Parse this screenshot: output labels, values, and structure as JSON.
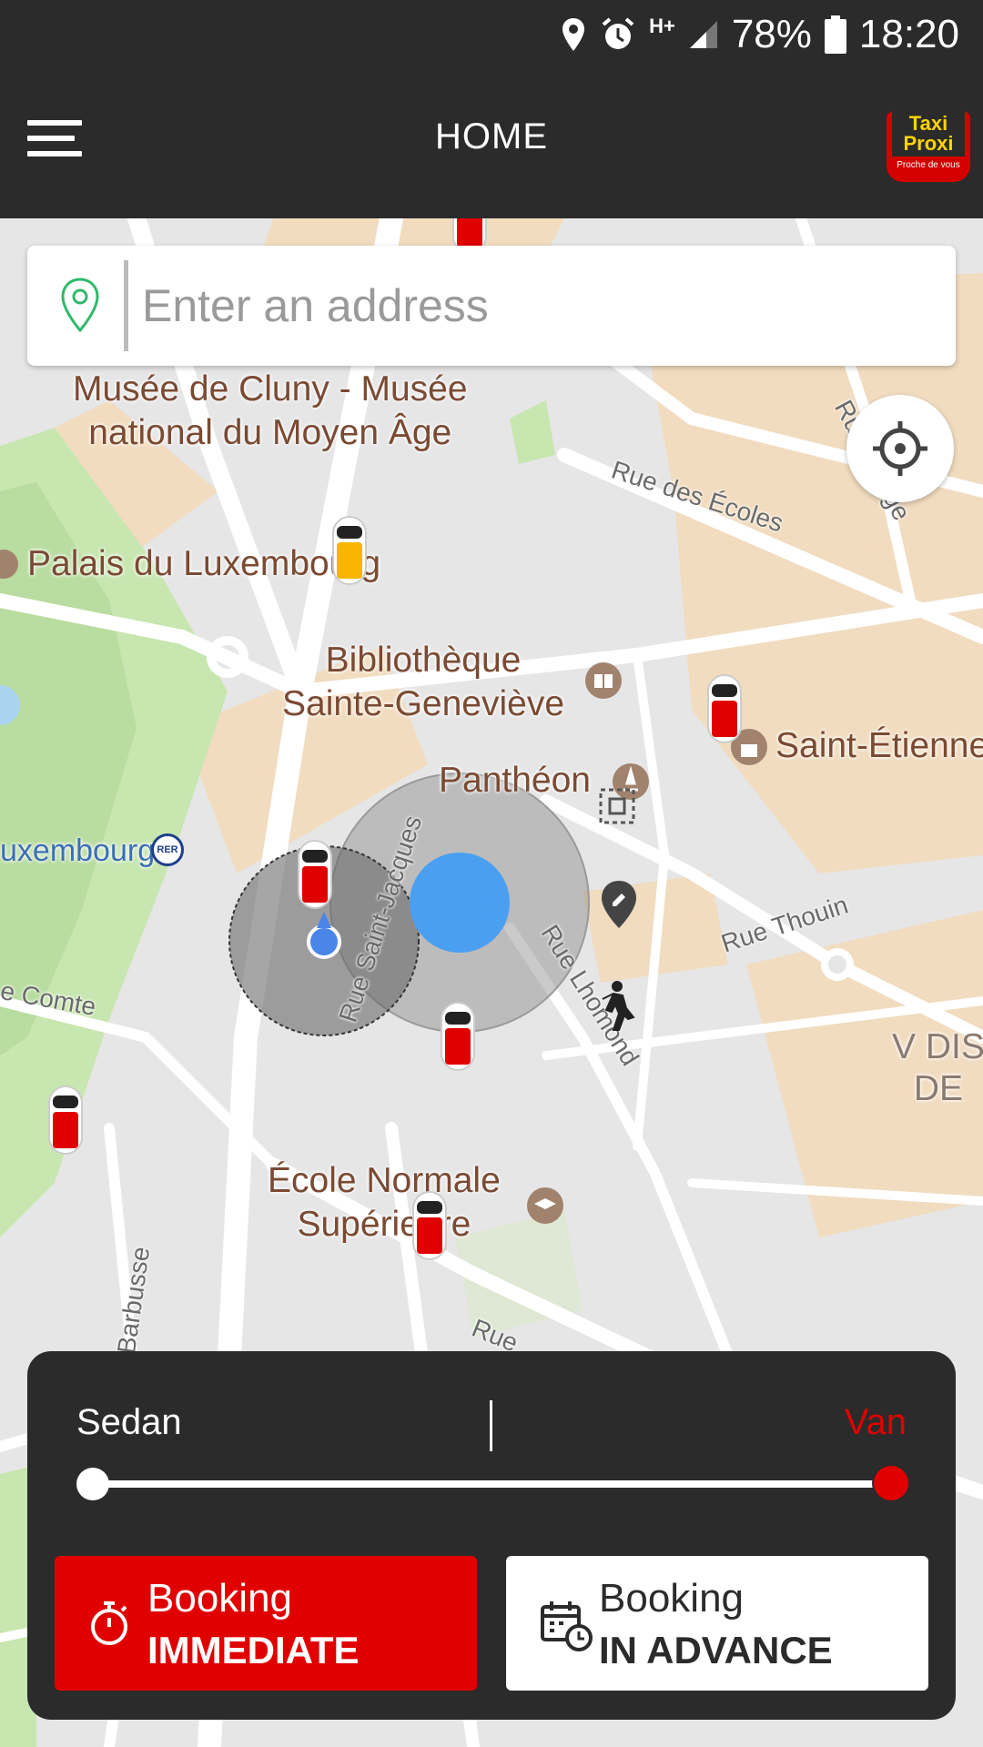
{
  "status_bar": {
    "network": "H+",
    "battery": "78%",
    "time": "18:20",
    "icons": [
      "location-icon",
      "alarm-icon",
      "network-icon",
      "signal-icon",
      "battery-icon"
    ]
  },
  "app_bar": {
    "title": "HOME",
    "logo": {
      "line1": "Taxi",
      "line2": "Proxi",
      "tagline": "Proche de vous"
    }
  },
  "search": {
    "placeholder": "Enter an address",
    "value": ""
  },
  "map": {
    "places": {
      "cluny": "Musée de Cluny - Musée\nnational du Moyen Âge",
      "luxembourg_palace": "Palais du Luxembourg",
      "bibliotheque": "Bibliothèque\nSainte-Geneviève",
      "pantheon": "Panthéon",
      "saint_etienne": "Saint-Étienne",
      "luxembourg_rer": "uxembourg",
      "ens": "École Normale\nSupérieure",
      "district": "V DIS\nDE"
    },
    "streets": {
      "ecoles": "Rue des Écoles",
      "monge": "Rue Monge",
      "thouin": "Rue Thouin",
      "saint_jacques": "Rue Saint-Jacques",
      "lhomond": "Rue Lhomond",
      "comte": "e Comte",
      "barbusse": "i Barbusse",
      "rue_bottom": "Rue"
    },
    "rer_badge": "RER"
  },
  "vehicle_selector": {
    "left_label": "Sedan",
    "right_label": "Van",
    "selected": "Van",
    "slider_value": 1.0,
    "colors": {
      "selected": "#e00000",
      "unselected": "#ffffff"
    }
  },
  "booking": {
    "immediate": {
      "line1": "Booking",
      "line2": "IMMEDIATE",
      "icon": "stopwatch-icon"
    },
    "advance": {
      "line1": "Booking",
      "line2": "IN ADVANCE",
      "icon": "calendar-clock-icon"
    }
  },
  "colors": {
    "brand_red": "#e00000",
    "brand_yellow": "#ffd400",
    "bar_dark": "#2b2b2b",
    "user_location_blue": "#4a9ff0"
  }
}
